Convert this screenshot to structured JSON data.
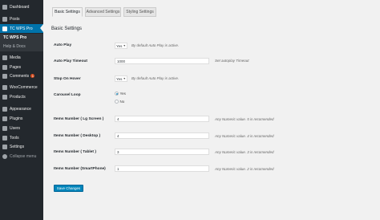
{
  "sidebar": {
    "items": [
      {
        "label": "Dashboard",
        "icon": "dashboard-icon"
      },
      {
        "label": "Posts",
        "icon": "pushpin-icon"
      },
      {
        "label": "TC WPS Pro",
        "icon": "slider-icon"
      },
      {
        "label": "Media",
        "icon": "media-icon"
      },
      {
        "label": "Pages",
        "icon": "page-icon"
      },
      {
        "label": "Comments",
        "icon": "comment-icon",
        "badge": "1"
      },
      {
        "label": "WooCommerce",
        "icon": "woocommerce-icon"
      },
      {
        "label": "Products",
        "icon": "product-icon"
      },
      {
        "label": "Appearance",
        "icon": "paintbrush-icon"
      },
      {
        "label": "Plugins",
        "icon": "plugin-icon"
      },
      {
        "label": "Users",
        "icon": "user-icon"
      },
      {
        "label": "Tools",
        "icon": "wrench-icon"
      },
      {
        "label": "Settings",
        "icon": "settings-icon"
      }
    ],
    "submenu": [
      "TC WPS Pro",
      "Help & Docs"
    ],
    "collapse_label": "Collapse menu"
  },
  "tabs": [
    "Basic Settings",
    "Advanced Settings",
    "Styling Settings"
  ],
  "section_title": "Basic Settings",
  "fields": {
    "auto_play": {
      "label": "Auto Play",
      "value": "Yes",
      "hint": "By default Auto Play is active."
    },
    "auto_play_timeout": {
      "label": "Auto Play Timeout",
      "value": "1000",
      "hint": "Set autoplay Timeout"
    },
    "stop_on_hover": {
      "label": "Stop On Hover",
      "value": "Yes",
      "hint": "By default Auto Play is active."
    },
    "carousel_loop": {
      "label": "Carousel Loop",
      "options": [
        "Yes",
        "No"
      ],
      "selected": "Yes"
    },
    "items_lg_screen": {
      "label": "Items Number ( Lg Screen )",
      "value": "4",
      "hint": "Any Numeric value. 5 is recomended"
    },
    "items_desktop": {
      "label": "Items Number ( Desktop )",
      "value": "4",
      "hint": "Any Numeric value. 4 is recomended"
    },
    "items_tablet": {
      "label": "Items Number ( Tablet )",
      "value": "3",
      "hint": "Any Numeric value. 3 is recomended"
    },
    "items_smartphone": {
      "label": "Items Number (SmartPhone)",
      "value": "1",
      "hint": "Any Numeric value. 2 is recomended"
    }
  },
  "save_button": "Save Changes",
  "colors": {
    "admin_bar": "#23282d",
    "accent": "#0073aa",
    "button": "#0085ba",
    "badge": "#d54e21"
  }
}
